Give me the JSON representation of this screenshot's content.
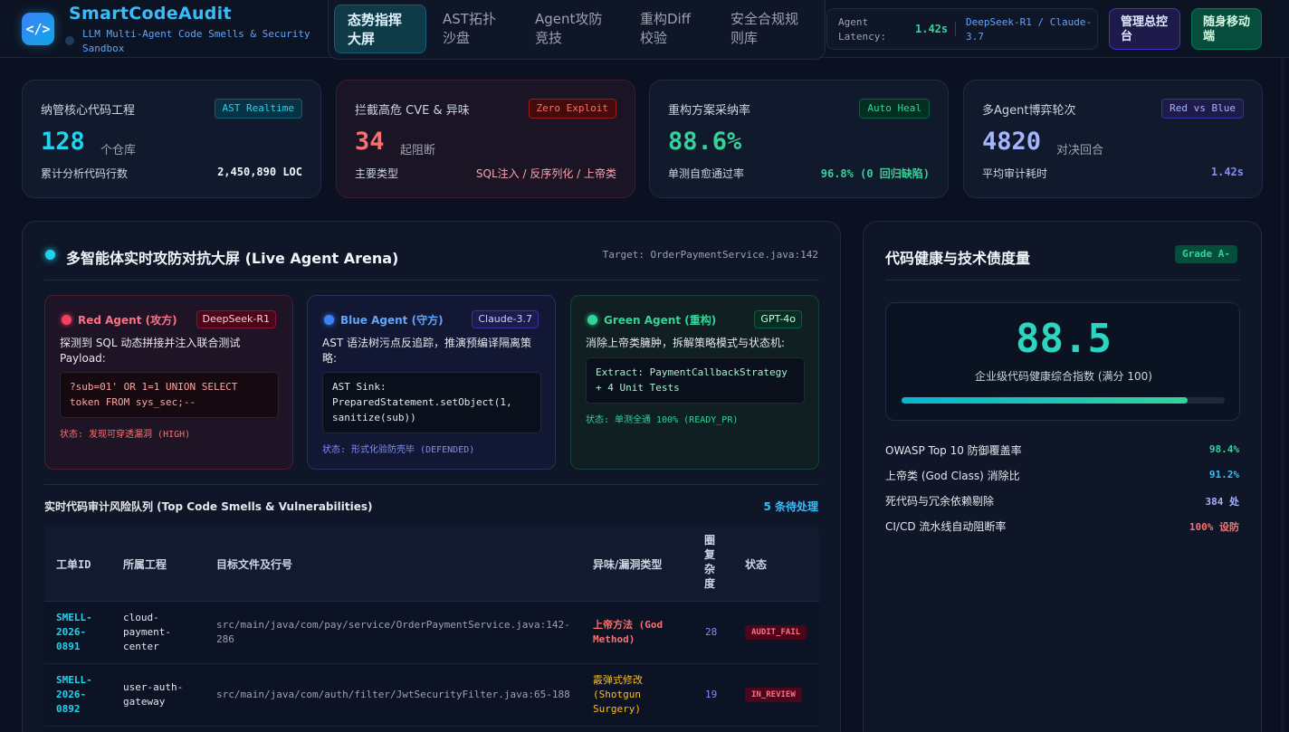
{
  "header": {
    "logo_glyph": "</>",
    "title": "SmartCodeAudit",
    "subtitle": "LLM Multi-Agent Code Smells & Security Sandbox",
    "nav": [
      {
        "label": "态势指挥大屏",
        "active": true
      },
      {
        "label": "AST拓扑沙盘",
        "active": false
      },
      {
        "label": "Agent攻防竞技",
        "active": false
      },
      {
        "label": "重构Diff校验",
        "active": false
      },
      {
        "label": "安全合规规则库",
        "active": false
      }
    ],
    "latency_label": "Agent Latency:",
    "latency_value": "1.42s",
    "models": "DeepSeek-R1 / Claude-3.7",
    "admin_button": "管理总控台",
    "mobile_button": "随身移动端"
  },
  "kpis": [
    {
      "label": "纳管核心代码工程",
      "badge": "AST Realtime",
      "value": "128",
      "unit": "个仓库",
      "foot_label": "累计分析代码行数",
      "foot_value": "2,450,890 LOC",
      "accent": "#22d3ee"
    },
    {
      "label": "拦截高危 CVE & 异味",
      "badge": "Zero Exploit",
      "value": "34",
      "unit": "起阻断",
      "foot_label": "主要类型",
      "foot_value": "SQL注入 / 反序列化 / 上帝类",
      "accent": "#f87171"
    },
    {
      "label": "重构方案采纳率",
      "badge": "Auto Heal",
      "value": "88.6%",
      "unit": "",
      "foot_label": "单测自愈通过率",
      "foot_value": "96.8% (0 回归缺陷)",
      "accent": "#34d399"
    },
    {
      "label": "多Agent博弈轮次",
      "badge": "Red vs Blue",
      "value": "4820",
      "unit": "对决回合",
      "foot_label": "平均审计耗时",
      "foot_value": "1.42s",
      "accent": "#a5b4fc"
    }
  ],
  "arena": {
    "title": "多智能体实时攻防对抗大屏 (Live Agent Arena)",
    "target": "Target: OrderPaymentService.java:142",
    "agents": [
      {
        "name": "Red Agent (攻方)",
        "model": "DeepSeek-R1",
        "desc": "探测到 SQL 动态拼接并注入联合测试 Payload:",
        "code": "?sub=01' OR 1=1 UNION SELECT token FROM sys_sec;--",
        "status": "状态: 发现可穿透漏洞 (HIGH)"
      },
      {
        "name": "Blue Agent (守方)",
        "model": "Claude-3.7",
        "desc": "AST 语法树污点反追踪，推演预编译隔离策略:",
        "code": "AST Sink: PreparedStatement.setObject(1, sanitize(sub))",
        "status": "状态: 形式化验防壳毕 (DEFENDED)"
      },
      {
        "name": "Green Agent (重构)",
        "model": "GPT-4o",
        "desc": "消除上帝类臃肿，拆解策略模式与状态机:",
        "code": "Extract: PaymentCallbackStrategy + 4 Unit Tests",
        "status": "状态: 单测全通 100% (READY_PR)"
      }
    ],
    "queue_title": "实时代码审计风险队列 (Top Code Smells & Vulnerabilities)",
    "queue_count": "5 条待处理",
    "columns": [
      "工单ID",
      "所属工程",
      "目标文件及行号",
      "异味/漏洞类型",
      "圈复杂度",
      "状态"
    ],
    "rows": [
      {
        "id": "SMELL-2026-0891",
        "project": "cloud-payment-center",
        "file": "src/main/java/com/pay/service/OrderPaymentService.java:142-286",
        "type": "上帝方法 (God Method)",
        "complexity": "28",
        "status": "AUDIT_FAIL"
      },
      {
        "id": "SMELL-2026-0892",
        "project": "user-auth-gateway",
        "file": "src/main/java/com/auth/filter/JwtSecurityFilter.java:65-188",
        "type": "霰弹式修改 (Shotgun Surgery)",
        "complexity": "19",
        "status": "IN_REVIEW"
      }
    ]
  },
  "health": {
    "title": "代码健康与技术债度量",
    "grade": "Grade A-",
    "score": "88.5",
    "score_label": "企业级代码健康综合指数 (满分 100)",
    "score_fraction": 0.885,
    "metrics": [
      {
        "label": "OWASP Top 10 防御覆盖率",
        "value": "98.4%",
        "color": "#34d399"
      },
      {
        "label": "上帝类 (God Class) 消除比",
        "value": "91.2%",
        "color": "#38bdf8"
      },
      {
        "label": "死代码与冗余依赖剔除",
        "value": "384 处",
        "color": "#a5b4fc"
      },
      {
        "label": "CI/CD 流水线自动阻断率",
        "value": "100% 设防",
        "color": "#f87171"
      }
    ]
  }
}
